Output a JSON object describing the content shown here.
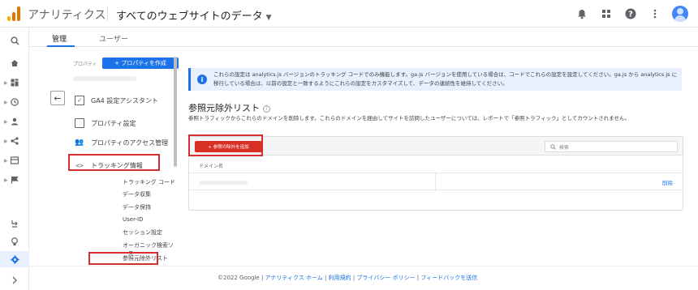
{
  "topbar": {
    "app_name": "アナリティクス",
    "account_selector": "すべてのウェブサイトのデータ",
    "logo_colors": [
      "#f9ab00",
      "#e37400",
      "#e37400"
    ]
  },
  "tabs": [
    {
      "label": "管理"
    },
    {
      "label": "ユーザー"
    }
  ],
  "property": {
    "label": "プロパティ",
    "create_button": "+ プロパティを作成"
  },
  "menu": [
    {
      "label": "GA4 設定アシスタント",
      "icon": "checklist-icon"
    },
    {
      "label": "プロパティ設定",
      "icon": "settings-box-icon"
    },
    {
      "label": "プロパティのアクセス管理",
      "icon": "people-icon"
    },
    {
      "label": "トラッキング情報",
      "icon": "code-icon"
    }
  ],
  "submenu": [
    "トラッキング コード",
    "データ収集",
    "データ保持",
    "User-ID",
    "セッション設定",
    "オーガニック検索ソース",
    "参照元除外リスト"
  ],
  "info": {
    "text": "これらの設定は analytics.js バージョンのトラッキング コードでのみ機能します。ga.js バージョンを使用している場合は、コードでこれらの設定を設定してください。ga.js から analytics.js に移行している場合は、以前の設定と一致するようにこれらの設定をカスタマイズして、データの連続性を維持してください。"
  },
  "section": {
    "title": "参照元除外リスト",
    "description": "参照トラフィックからこれらのドメインを削除します。これらのドメインを経由してサイトを訪問したユーザーについては、レポートで「参照トラフィック」としてカウントされません。"
  },
  "table": {
    "add_button": "+ 参照の除外を追加",
    "search_placeholder": "検索",
    "column_header": "ドメイン名",
    "delete_label": "削除"
  },
  "footer": {
    "copyright": "©2022 Google | ",
    "link_home": "アナリティクス ホーム",
    "sep1": " | ",
    "link_terms": "利用規約",
    "sep2": " | ",
    "link_privacy": "プライバシー ポリシー",
    "sep3": " | ",
    "link_feedback": "フィードバックを送信"
  }
}
